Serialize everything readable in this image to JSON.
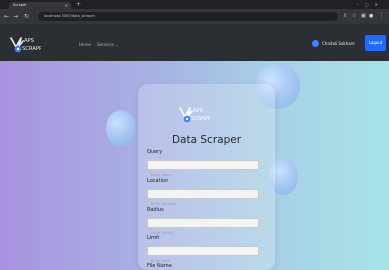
{
  "browser": {
    "tab_title": "Scraper",
    "url": "localhost:3000/data_scraper"
  },
  "nav": {
    "brand": "MAPS SCRAPPER",
    "links": [
      "Home",
      "Services ⌄"
    ],
    "user_name": "Chaitali Sakhare",
    "logout_label": "Logout"
  },
  "form": {
    "brand": "MAPS SCRAPPER",
    "title": "Data Scraper",
    "fields": [
      {
        "label": "Query",
        "placeholder": "Enter query"
      },
      {
        "label": "Location",
        "placeholder": "Enter location"
      },
      {
        "label": "Radius",
        "placeholder": "Enter radius"
      },
      {
        "label": "Limit",
        "placeholder": "Enter limit"
      },
      {
        "label": "File Name",
        "placeholder": ""
      }
    ]
  },
  "colors": {
    "nav_bg": "#2b2f34",
    "logout_bg": "#1f6bff",
    "gradient_left": "#a892e2",
    "gradient_right": "#a6e3e8"
  }
}
